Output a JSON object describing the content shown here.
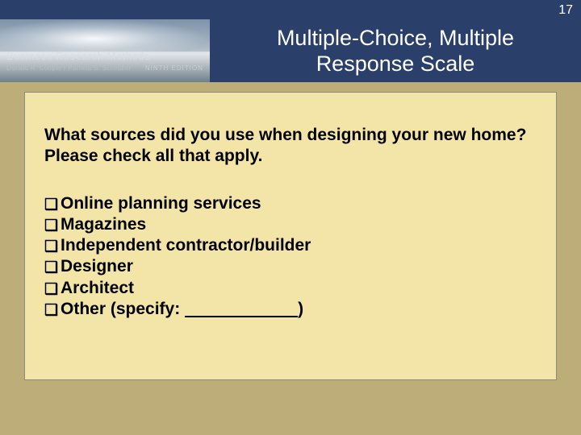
{
  "page_number": "17",
  "book": {
    "title": "Business Research Methods",
    "authors": "Donald R. Cooper / Pamela S. Schindler",
    "edition": "NINTH EDITION"
  },
  "slide_title": "Multiple-Choice, Multiple Response Scale",
  "question": "What sources did you use when designing your new home? Please check all that apply.",
  "checkbox_glyph": "❑",
  "options": [
    "Online planning services",
    "Magazines",
    "Independent contractor/builder",
    "Designer",
    "Architect"
  ],
  "other_option": {
    "prefix": "Other (specify: ",
    "blank": "                        ",
    "suffix": ")"
  }
}
